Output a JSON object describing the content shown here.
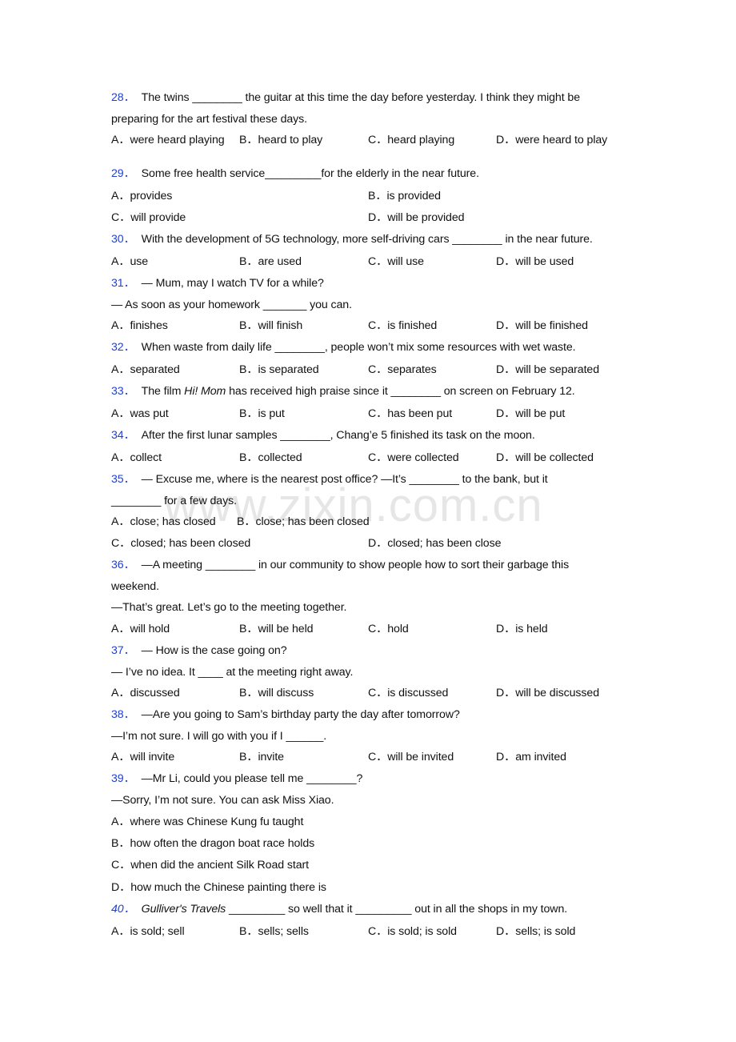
{
  "watermark": "www.zixin.com.cn",
  "questions": [
    {
      "num": "28．",
      "lines": [
        "The twins ________ the guitar at this time the day before yesterday. I think they might be",
        "preparing for the art festival these days."
      ],
      "options": [
        "A．were heard playing",
        "B．heard to play",
        "C．heard playing",
        "D．were heard to play"
      ]
    },
    {
      "num": "29．",
      "lines": [
        "Some free health service_________for the elderly in the near future."
      ],
      "options": [
        "A．provides",
        "B．is provided",
        "C．will provide",
        "D．will be provided"
      ]
    },
    {
      "num": "30．",
      "lines": [
        "With the development of 5G technology, more self-driving cars ________ in the near future."
      ],
      "options": [
        "A．use",
        "B．are used",
        "C．will use",
        "D．will be used"
      ]
    },
    {
      "num": "31．",
      "lines": [
        "— Mum, may I watch TV for a while?",
        "— As soon as your homework _______ you can."
      ],
      "options": [
        "A．finishes",
        "B．will finish",
        "C．is finished",
        "D．will be finished"
      ]
    },
    {
      "num": "32．",
      "lines": [
        "When waste from daily life ________, people won’t mix some resources with wet waste."
      ],
      "options": [
        "A．separated",
        "B．is separated",
        "C．separates",
        "D．will be separated"
      ]
    },
    {
      "num": "33．",
      "pre": "The film ",
      "italic": "Hi! Mom",
      "post": " has received high praise since it ________ on screen on February 12.",
      "options": [
        "A．was put",
        "B．is put",
        "C．has been put",
        "D．will be put"
      ]
    },
    {
      "num": "34．",
      "lines": [
        "After the first lunar samples ________, Chang’e 5 finished its task on the moon."
      ],
      "options": [
        "A．collect",
        "B．collected",
        "C．were collected",
        "D．will be collected"
      ]
    },
    {
      "num": "35．",
      "lines": [
        "— Excuse me, where is the nearest post office?  —It’s ________ to the bank, but it",
        "________ for a few days."
      ],
      "options": [
        "A．close; has closed",
        "B．close; has been closed",
        "C．closed; has been closed",
        "D．closed; has been close"
      ]
    },
    {
      "num": "36．",
      "lines": [
        "—A meeting ________ in our community to show people how to sort their garbage this",
        "weekend.",
        "—That’s great. Let’s go to the meeting together."
      ],
      "options": [
        "A．will hold",
        "B．will be held",
        "C．hold",
        "D．is held"
      ]
    },
    {
      "num": "37．",
      "lines": [
        "— How is the case going on?",
        "— I’ve no idea. It ____ at the meeting right away."
      ],
      "options": [
        "A．discussed",
        "B．will discuss",
        "C．is discussed",
        "D．will be discussed"
      ]
    },
    {
      "num": "38．",
      "lines": [
        "—Are you going to Sam’s birthday party the day after tomorrow?",
        "—I’m not sure. I will go with you if I ______."
      ],
      "options": [
        "A．will invite",
        "B．invite",
        "C．will be invited",
        "D．am invited"
      ]
    },
    {
      "num": "39．",
      "lines": [
        "—Mr Li, could you please tell me ________?",
        "—Sorry, I’m not sure. You can ask Miss Xiao."
      ],
      "options": [
        "A．where was Chinese Kung fu taught",
        "B．how often the dragon boat race holds",
        "C．when did the ancient Silk Road start",
        "D．how much the Chinese painting there is"
      ]
    },
    {
      "num": "40．",
      "italic": "Gulliver's Travels",
      "post": " _________ so well that it _________ out in all the shops in my town.",
      "options": [
        "A．is sold; sell",
        "B．sells; sells",
        "C．is sold; is sold",
        "D．sells; is sold"
      ]
    }
  ]
}
